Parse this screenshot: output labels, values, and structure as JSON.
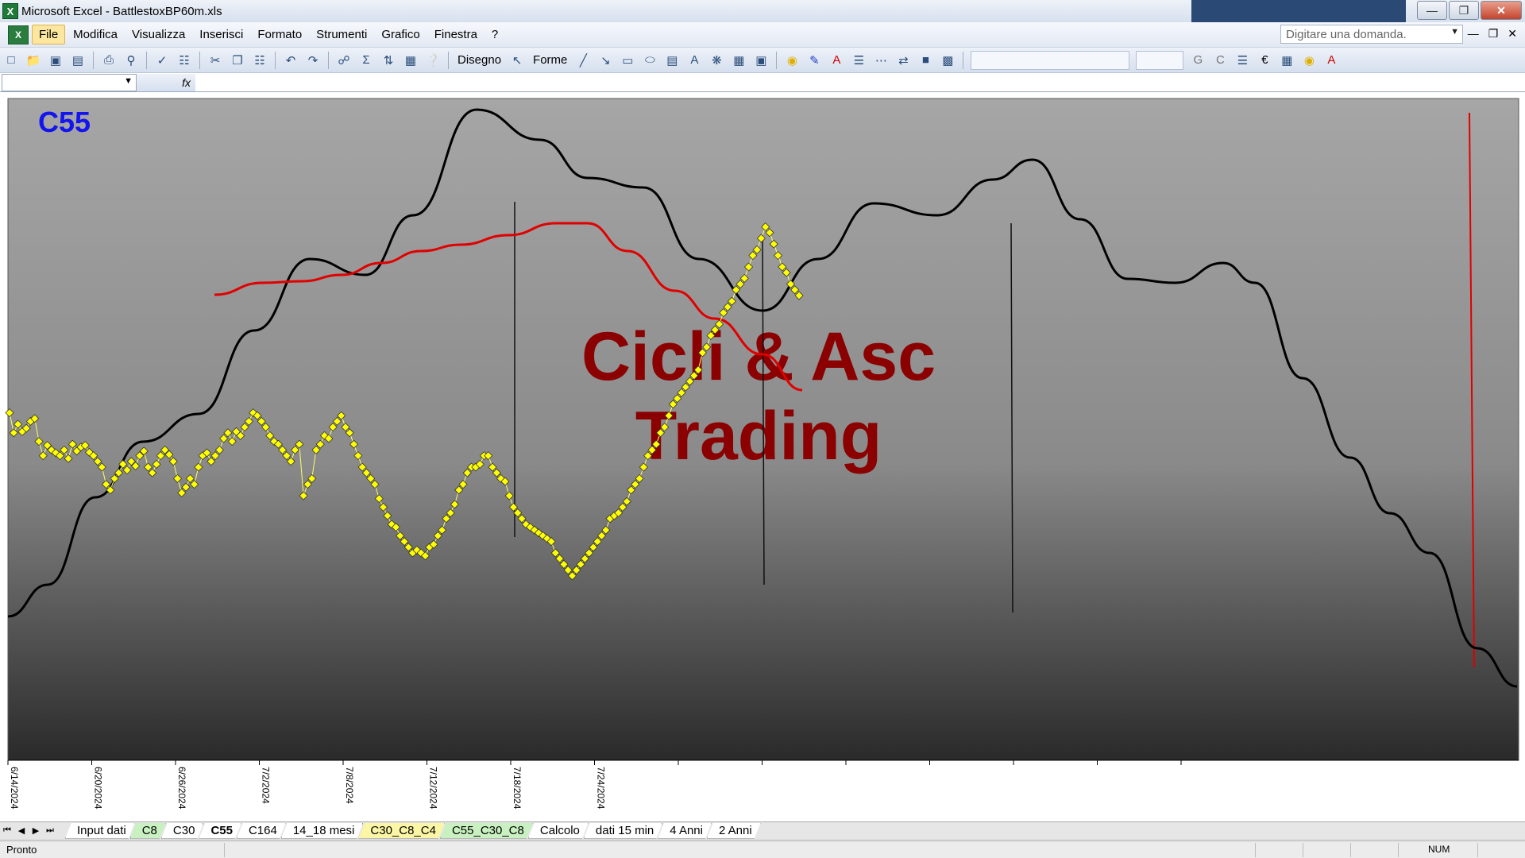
{
  "window": {
    "title": "Microsoft Excel - BattlestoxBP60m.xls",
    "icon": "excel-icon",
    "buttons": [
      "minimize",
      "maximize",
      "close"
    ]
  },
  "menu": {
    "items": [
      "File",
      "Modifica",
      "Visualizza",
      "Inserisci",
      "Formato",
      "Strumenti",
      "Grafico",
      "Finestra",
      "?"
    ],
    "active": "File",
    "ask_placeholder": "Digitare una domanda."
  },
  "toolbar": {
    "disegno_label": "Disegno",
    "forme_label": "Forme",
    "bold_label": "G",
    "italic_label": "C",
    "euro_label": "€"
  },
  "formula": {
    "fx_label": "fx"
  },
  "chart_data": {
    "type": "line",
    "title": "C55",
    "watermark": [
      "Cicli & Asc",
      "Trading"
    ],
    "x_tick_labels": [
      "6/14/2024",
      "6/20/2024",
      "6/26/2024",
      "7/2/2024",
      "7/8/2024",
      "7/12/2024",
      "7/18/2024",
      "7/24/2024",
      "",
      "",
      "",
      "",
      "",
      "",
      ""
    ],
    "series": [
      {
        "role": "price",
        "color": "#ffff00",
        "marker": "diamond",
        "values": [
          545,
          510,
          525,
          512,
          518,
          530,
          535,
          495,
          470,
          488,
          480,
          475,
          470,
          480,
          465,
          490,
          478,
          485,
          488,
          476,
          470,
          460,
          450,
          420,
          410,
          430,
          440,
          455,
          445,
          460,
          452,
          470,
          478,
          450,
          440,
          455,
          470,
          480,
          472,
          460,
          430,
          405,
          415,
          430,
          420,
          450,
          470,
          475,
          460,
          470,
          480,
          500,
          510,
          495,
          512,
          505,
          520,
          530,
          545,
          540,
          530,
          520,
          505,
          495,
          490,
          480,
          470,
          460,
          480,
          490,
          400,
          420,
          430,
          480,
          490,
          505,
          500,
          520,
          530,
          540,
          520,
          510,
          490,
          470,
          450,
          440,
          430,
          420,
          395,
          380,
          365,
          350,
          345,
          330,
          320,
          310,
          300,
          305,
          300,
          295,
          310,
          315,
          330,
          340,
          360,
          370,
          385,
          410,
          420,
          440,
          450,
          450,
          455,
          470,
          470,
          450,
          440,
          430,
          425,
          400,
          380,
          370,
          360,
          350,
          345,
          340,
          335,
          330,
          325,
          320,
          300,
          290,
          280,
          270,
          260,
          270,
          280,
          290,
          300,
          310,
          320,
          330,
          340,
          360,
          365,
          370,
          380,
          390,
          410,
          420,
          430,
          450,
          470,
          480,
          490,
          510,
          520,
          540,
          560,
          570,
          580,
          590,
          600,
          610,
          620,
          650,
          660,
          680,
          690,
          700,
          720,
          730,
          740,
          760,
          770,
          780,
          800,
          820,
          830,
          850,
          870,
          860,
          840,
          820,
          800,
          790,
          770,
          760,
          750
        ]
      },
      {
        "role": "moving-average",
        "color": "#e00000"
      },
      {
        "role": "cycle",
        "color": "#000000"
      }
    ],
    "grid": false,
    "legend": "none"
  },
  "sheets": {
    "tabs": [
      {
        "label": "Input dati",
        "style": "normal"
      },
      {
        "label": "C8",
        "style": "green"
      },
      {
        "label": "C30",
        "style": "normal"
      },
      {
        "label": "C55",
        "style": "active"
      },
      {
        "label": "C164",
        "style": "normal"
      },
      {
        "label": "14_18 mesi",
        "style": "normal"
      },
      {
        "label": "C30_C8_C4",
        "style": "yellow"
      },
      {
        "label": "C55_C30_C8",
        "style": "green"
      },
      {
        "label": "Calcolo",
        "style": "normal"
      },
      {
        "label": "dati 15 min",
        "style": "normal"
      },
      {
        "label": "4 Anni",
        "style": "normal"
      },
      {
        "label": "2 Anni",
        "style": "normal"
      }
    ]
  },
  "status": {
    "left": "Pronto",
    "num": "NUM"
  }
}
